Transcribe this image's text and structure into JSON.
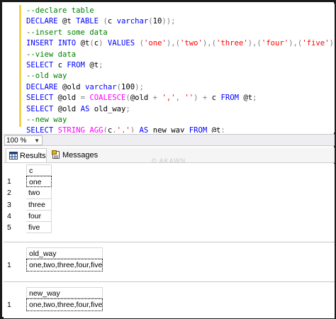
{
  "editor": {
    "lines": [
      [
        {
          "t": "--declare table",
          "c": "cm"
        }
      ],
      [
        {
          "t": "DECLARE",
          "c": "kw"
        },
        {
          "t": " @t ",
          "c": "tx"
        },
        {
          "t": "TABLE",
          "c": "kw"
        },
        {
          "t": " ",
          "c": "tx"
        },
        {
          "t": "(",
          "c": "gr"
        },
        {
          "t": "c ",
          "c": "tx"
        },
        {
          "t": "varchar",
          "c": "kw"
        },
        {
          "t": "(",
          "c": "gr"
        },
        {
          "t": "10",
          "c": "tx"
        },
        {
          "t": "));",
          "c": "gr"
        }
      ],
      [
        {
          "t": "--insert some data",
          "c": "cm"
        }
      ],
      [
        {
          "t": "INSERT",
          "c": "kw"
        },
        {
          "t": " ",
          "c": "tx"
        },
        {
          "t": "INTO",
          "c": "kw"
        },
        {
          "t": " @t",
          "c": "tx"
        },
        {
          "t": "(",
          "c": "gr"
        },
        {
          "t": "c",
          "c": "tx"
        },
        {
          "t": ")",
          "c": "gr"
        },
        {
          "t": " ",
          "c": "tx"
        },
        {
          "t": "VALUES",
          "c": "kw"
        },
        {
          "t": " ",
          "c": "tx"
        },
        {
          "t": "(",
          "c": "gr"
        },
        {
          "t": "'one'",
          "c": "str"
        },
        {
          "t": "),(",
          "c": "gr"
        },
        {
          "t": "'two'",
          "c": "str"
        },
        {
          "t": "),(",
          "c": "gr"
        },
        {
          "t": "'three'",
          "c": "str"
        },
        {
          "t": "),(",
          "c": "gr"
        },
        {
          "t": "'four'",
          "c": "str"
        },
        {
          "t": "),(",
          "c": "gr"
        },
        {
          "t": "'five'",
          "c": "str"
        },
        {
          "t": ");",
          "c": "gr"
        }
      ],
      [
        {
          "t": "--view data",
          "c": "cm"
        }
      ],
      [
        {
          "t": "SELECT",
          "c": "kw"
        },
        {
          "t": " c ",
          "c": "tx"
        },
        {
          "t": "FROM",
          "c": "kw"
        },
        {
          "t": " @t",
          "c": "tx"
        },
        {
          "t": ";",
          "c": "gr"
        }
      ],
      [
        {
          "t": "--old way",
          "c": "cm"
        }
      ],
      [
        {
          "t": "DECLARE",
          "c": "kw"
        },
        {
          "t": " @old ",
          "c": "tx"
        },
        {
          "t": "varchar",
          "c": "kw"
        },
        {
          "t": "(",
          "c": "gr"
        },
        {
          "t": "100",
          "c": "tx"
        },
        {
          "t": ");",
          "c": "gr"
        }
      ],
      [
        {
          "t": "SELECT",
          "c": "kw"
        },
        {
          "t": " @old ",
          "c": "tx"
        },
        {
          "t": "=",
          "c": "gr"
        },
        {
          "t": " ",
          "c": "tx"
        },
        {
          "t": "COALESCE",
          "c": "fn"
        },
        {
          "t": "(",
          "c": "gr"
        },
        {
          "t": "@old ",
          "c": "tx"
        },
        {
          "t": "+",
          "c": "gr"
        },
        {
          "t": " ",
          "c": "tx"
        },
        {
          "t": "','",
          "c": "str"
        },
        {
          "t": ",",
          "c": "gr"
        },
        {
          "t": " ",
          "c": "tx"
        },
        {
          "t": "''",
          "c": "str"
        },
        {
          "t": ")",
          "c": "gr"
        },
        {
          "t": " ",
          "c": "tx"
        },
        {
          "t": "+",
          "c": "gr"
        },
        {
          "t": " c ",
          "c": "tx"
        },
        {
          "t": "FROM",
          "c": "kw"
        },
        {
          "t": " @t",
          "c": "tx"
        },
        {
          "t": ";",
          "c": "gr"
        }
      ],
      [
        {
          "t": "SELECT",
          "c": "kw"
        },
        {
          "t": " @old ",
          "c": "tx"
        },
        {
          "t": "AS",
          "c": "kw"
        },
        {
          "t": " old_way",
          "c": "tx"
        },
        {
          "t": ";",
          "c": "gr"
        }
      ],
      [
        {
          "t": "--new way",
          "c": "cm"
        }
      ],
      [
        {
          "t": "SELECT",
          "c": "kw"
        },
        {
          "t": " ",
          "c": "tx"
        },
        {
          "t": "STRING_AGG",
          "c": "fn"
        },
        {
          "t": "(",
          "c": "gr"
        },
        {
          "t": "c",
          "c": "tx"
        },
        {
          "t": ",",
          "c": "gr"
        },
        {
          "t": "','",
          "c": "str"
        },
        {
          "t": ")",
          "c": "gr"
        },
        {
          "t": " ",
          "c": "tx"
        },
        {
          "t": "AS",
          "c": "kw"
        },
        {
          "t": " new_way ",
          "c": "tx"
        },
        {
          "t": "FROM",
          "c": "kw"
        },
        {
          "t": " @t",
          "c": "tx"
        },
        {
          "t": ";",
          "c": "gr"
        }
      ]
    ]
  },
  "zoom": {
    "value": "100 %"
  },
  "tabs": {
    "results": "Results",
    "messages": "Messages"
  },
  "watermark": "© AKAWN",
  "grid1": {
    "header": "c",
    "rows": [
      [
        "1",
        "one"
      ],
      [
        "2",
        "two"
      ],
      [
        "3",
        "three"
      ],
      [
        "4",
        "four"
      ],
      [
        "5",
        "five"
      ]
    ]
  },
  "grid2": {
    "header": "old_way",
    "rows": [
      [
        "1",
        "one,two,three,four,five"
      ]
    ]
  },
  "grid3": {
    "header": "new_way",
    "rows": [
      [
        "1",
        "one,two,three,four,five"
      ]
    ]
  },
  "colors": {
    "keyword": "#0000ff",
    "comment": "#008000",
    "string": "#ff0000",
    "function": "#ff00ff",
    "operator": "#808080"
  }
}
